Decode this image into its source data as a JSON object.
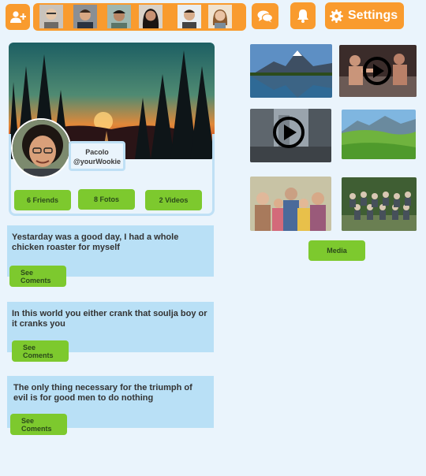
{
  "topbar": {
    "add_friend_icon": "user-plus-icon",
    "friends": [
      {
        "name": "friend-1"
      },
      {
        "name": "friend-2"
      },
      {
        "name": "friend-3"
      },
      {
        "name": "friend-4"
      },
      {
        "name": "friend-5"
      },
      {
        "name": "friend-6"
      }
    ],
    "chat_icon": "comments-icon",
    "bell_icon": "bell-icon",
    "settings_label": "Settings"
  },
  "profile": {
    "name": "Pacolo",
    "handle": "@yourWookie",
    "friends_label": "6 Friends",
    "fotos_label": "8 Fotos",
    "videos_label": "2 Videos"
  },
  "posts": [
    {
      "text": "Yestarday was a good day, I had a whole chicken roaster for myself",
      "button_label": "See Coments"
    },
    {
      "text": "In this world you either crank that soulja boy or it cranks you",
      "button_label": "See Coments"
    },
    {
      "text": "The only thing necessary for the triumph of evil is for good men to do nothing",
      "button_label": "See Coments"
    }
  ],
  "media": {
    "items": [
      {
        "kind": "image",
        "subject": "mountain-lake"
      },
      {
        "kind": "video",
        "subject": "fight"
      },
      {
        "kind": "video",
        "subject": "city-street"
      },
      {
        "kind": "image",
        "subject": "green-valley"
      },
      {
        "kind": "image",
        "subject": "family-photo"
      },
      {
        "kind": "image",
        "subject": "group-photo"
      }
    ],
    "button_label": "Media"
  },
  "colors": {
    "accent_orange": "#f99b2e",
    "accent_green": "#7dc92e",
    "post_bg": "#b9e0f6",
    "page_bg": "#eaf4fc"
  }
}
